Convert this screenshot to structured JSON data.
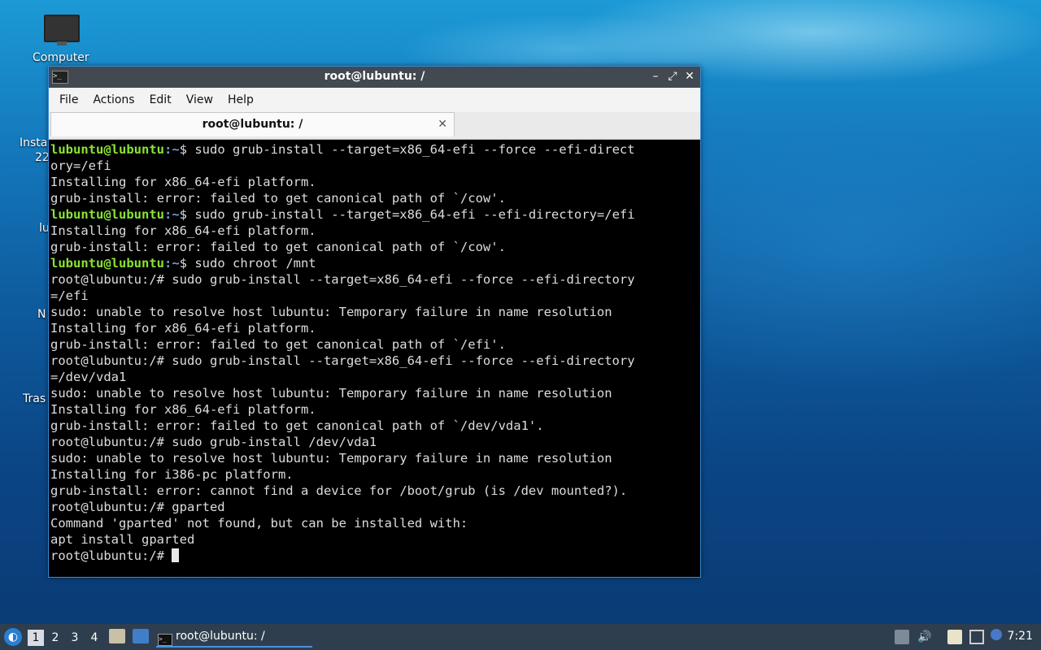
{
  "desktop": {
    "icons": [
      {
        "label": "Computer"
      },
      {
        "label": "Insta"
      },
      {
        "label": "22"
      },
      {
        "label": "lu"
      },
      {
        "label": "N"
      },
      {
        "label": "Tras"
      }
    ]
  },
  "window": {
    "title": "root@lubuntu: /",
    "menu": [
      "File",
      "Actions",
      "Edit",
      "View",
      "Help"
    ],
    "tab_label": "root@lubuntu: /",
    "controls": {
      "minimize": "–",
      "maximize": "⤢",
      "close": "✕"
    }
  },
  "terminal": {
    "lines": [
      {
        "user": "lubuntu@lubuntu",
        "path": ":~",
        "prompt_end": "$",
        "text": " sudo grub-install --target=x86_64-efi --force --efi-direct"
      },
      {
        "text": "ory=/efi"
      },
      {
        "text": "Installing for x86_64-efi platform."
      },
      {
        "text": "grub-install: error: failed to get canonical path of `/cow'."
      },
      {
        "user": "lubuntu@lubuntu",
        "path": ":~",
        "prompt_end": "$",
        "text": " sudo grub-install --target=x86_64-efi --efi-directory=/efi"
      },
      {
        "text": "Installing for x86_64-efi platform."
      },
      {
        "text": "grub-install: error: failed to get canonical path of `/cow'."
      },
      {
        "user": "lubuntu@lubuntu",
        "path": ":~",
        "prompt_end": "$",
        "text": " sudo chroot /mnt"
      },
      {
        "text": "root@lubuntu:/# sudo grub-install --target=x86_64-efi --force --efi-directory"
      },
      {
        "text": "=/efi"
      },
      {
        "text": "sudo: unable to resolve host lubuntu: Temporary failure in name resolution"
      },
      {
        "text": "Installing for x86_64-efi platform."
      },
      {
        "text": "grub-install: error: failed to get canonical path of `/efi'."
      },
      {
        "text": "root@lubuntu:/# sudo grub-install --target=x86_64-efi --force --efi-directory"
      },
      {
        "text": "=/dev/vda1"
      },
      {
        "text": "sudo: unable to resolve host lubuntu: Temporary failure in name resolution"
      },
      {
        "text": "Installing for x86_64-efi platform."
      },
      {
        "text": "grub-install: error: failed to get canonical path of `/dev/vda1'."
      },
      {
        "text": "root@lubuntu:/# sudo grub-install /dev/vda1"
      },
      {
        "text": "sudo: unable to resolve host lubuntu: Temporary failure in name resolution"
      },
      {
        "text": "Installing for i386-pc platform."
      },
      {
        "text": "grub-install: error: cannot find a device for /boot/grub (is /dev mounted?)."
      },
      {
        "text": "root@lubuntu:/# gparted"
      },
      {
        "text": "Command 'gparted' not found, but can be installed with:"
      },
      {
        "text": "apt install gparted"
      }
    ],
    "current_prompt": "root@lubuntu:/# "
  },
  "taskbar": {
    "workspaces": [
      "1",
      "2",
      "3",
      "4"
    ],
    "active_workspace": "1",
    "task_label": "root@lubuntu: /",
    "clock": "7:21"
  },
  "colors": {
    "accent": "#4a90e2",
    "prompt_user": "#8ae234",
    "prompt_path": "#729fcf"
  }
}
